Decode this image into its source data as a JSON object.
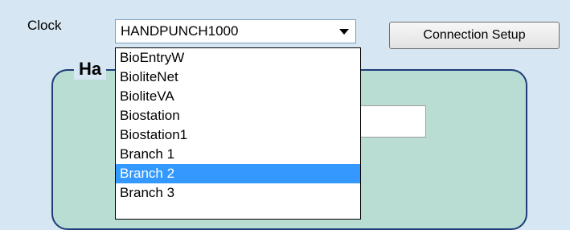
{
  "clock_label": "Clock",
  "clock_combo": {
    "selected": "HANDPUNCH1000",
    "options_visible": [
      "BioEntryW",
      "BioliteNet",
      "BioliteVA",
      "Biostation",
      "Biostation1",
      "Branch 1",
      "Branch 2",
      "Branch 3"
    ],
    "highlighted": "Branch 2"
  },
  "connection_setup_label": "Connection Setup",
  "groupbox_title": "Ha",
  "colors": {
    "background": "#d6e6f2",
    "groupbox_fill": "#b9ddd2",
    "groupbox_border": "#1d3c78",
    "selection": "#3399ff"
  },
  "icons": {
    "combo_arrow": "chevron-down-icon"
  }
}
